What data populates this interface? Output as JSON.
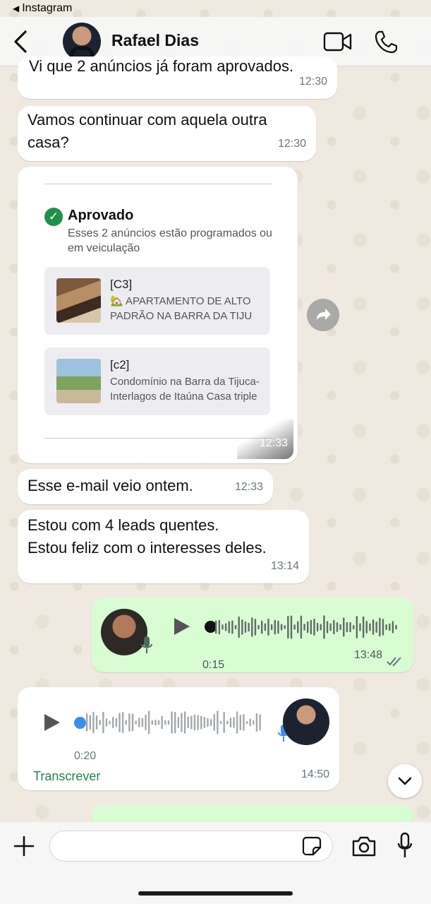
{
  "status_bar": {
    "back_app": "Instagram"
  },
  "header": {
    "contact_name": "Rafael Dias"
  },
  "messages": [
    {
      "text": "Vi que 2 anúncios já foram aprovados.",
      "time": "12:30"
    },
    {
      "text": "Vamos continuar com aquela outra casa?",
      "time": "12:30"
    },
    {
      "card": {
        "title": "Aprovado",
        "description": "Esses 2 anúncios estão programados ou em veiculação",
        "ads": [
          {
            "tag": "[C3]",
            "text": "🏡 APARTAMENTO DE ALTO PADRÃO NA BARRA DA TIJU"
          },
          {
            "tag": "[c2]",
            "text": "Condomínio na Barra da Tijuca- Interlagos de Itaúna Casa triple"
          }
        ]
      },
      "time": "12:33"
    },
    {
      "text": "Esse e-mail veio ontem.",
      "time": "12:33"
    },
    {
      "text": "Estou com 4 leads quentes.\nEstou feliz com o interesses deles.",
      "time": "13:14"
    },
    {
      "voice": {
        "duration": "0:15",
        "direction": "outgoing"
      },
      "time": "13:48"
    },
    {
      "voice": {
        "duration": "0:20",
        "direction": "incoming"
      },
      "transcribe_label": "Transcrever",
      "time": "14:50"
    }
  ],
  "colors": {
    "outgoing_bubble": "#d9fdd3",
    "incoming_bubble": "#ffffff",
    "accent_green": "#238450",
    "check_green": "#20904a"
  },
  "icons": [
    "back-icon",
    "video-call-icon",
    "phone-icon",
    "check-circle-icon",
    "forward-icon",
    "play-icon",
    "mic-icon",
    "double-check-icon",
    "chevron-down-icon",
    "plus-icon",
    "sticker-icon",
    "camera-icon"
  ]
}
